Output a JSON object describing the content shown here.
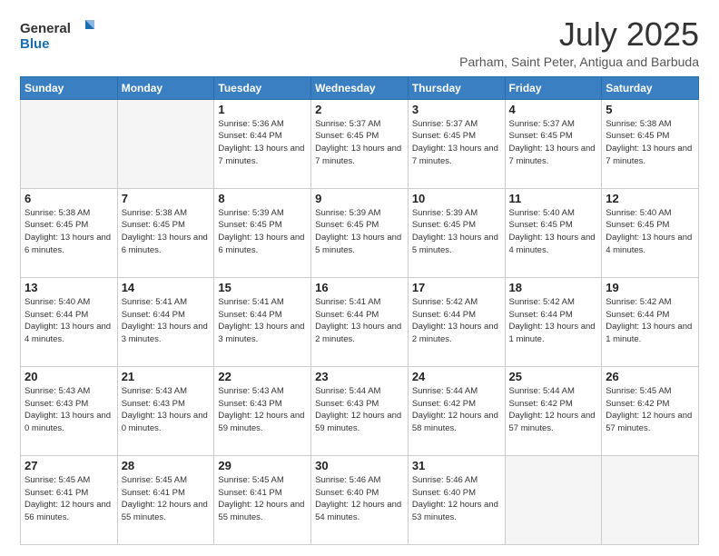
{
  "header": {
    "logo_line1": "General",
    "logo_line2": "Blue",
    "month": "July 2025",
    "location": "Parham, Saint Peter, Antigua and Barbuda"
  },
  "weekdays": [
    "Sunday",
    "Monday",
    "Tuesday",
    "Wednesday",
    "Thursday",
    "Friday",
    "Saturday"
  ],
  "weeks": [
    [
      {
        "day": "",
        "info": ""
      },
      {
        "day": "",
        "info": ""
      },
      {
        "day": "1",
        "info": "Sunrise: 5:36 AM\nSunset: 6:44 PM\nDaylight: 13 hours and 7 minutes."
      },
      {
        "day": "2",
        "info": "Sunrise: 5:37 AM\nSunset: 6:45 PM\nDaylight: 13 hours and 7 minutes."
      },
      {
        "day": "3",
        "info": "Sunrise: 5:37 AM\nSunset: 6:45 PM\nDaylight: 13 hours and 7 minutes."
      },
      {
        "day": "4",
        "info": "Sunrise: 5:37 AM\nSunset: 6:45 PM\nDaylight: 13 hours and 7 minutes."
      },
      {
        "day": "5",
        "info": "Sunrise: 5:38 AM\nSunset: 6:45 PM\nDaylight: 13 hours and 7 minutes."
      }
    ],
    [
      {
        "day": "6",
        "info": "Sunrise: 5:38 AM\nSunset: 6:45 PM\nDaylight: 13 hours and 6 minutes."
      },
      {
        "day": "7",
        "info": "Sunrise: 5:38 AM\nSunset: 6:45 PM\nDaylight: 13 hours and 6 minutes."
      },
      {
        "day": "8",
        "info": "Sunrise: 5:39 AM\nSunset: 6:45 PM\nDaylight: 13 hours and 6 minutes."
      },
      {
        "day": "9",
        "info": "Sunrise: 5:39 AM\nSunset: 6:45 PM\nDaylight: 13 hours and 5 minutes."
      },
      {
        "day": "10",
        "info": "Sunrise: 5:39 AM\nSunset: 6:45 PM\nDaylight: 13 hours and 5 minutes."
      },
      {
        "day": "11",
        "info": "Sunrise: 5:40 AM\nSunset: 6:45 PM\nDaylight: 13 hours and 4 minutes."
      },
      {
        "day": "12",
        "info": "Sunrise: 5:40 AM\nSunset: 6:45 PM\nDaylight: 13 hours and 4 minutes."
      }
    ],
    [
      {
        "day": "13",
        "info": "Sunrise: 5:40 AM\nSunset: 6:44 PM\nDaylight: 13 hours and 4 minutes."
      },
      {
        "day": "14",
        "info": "Sunrise: 5:41 AM\nSunset: 6:44 PM\nDaylight: 13 hours and 3 minutes."
      },
      {
        "day": "15",
        "info": "Sunrise: 5:41 AM\nSunset: 6:44 PM\nDaylight: 13 hours and 3 minutes."
      },
      {
        "day": "16",
        "info": "Sunrise: 5:41 AM\nSunset: 6:44 PM\nDaylight: 13 hours and 2 minutes."
      },
      {
        "day": "17",
        "info": "Sunrise: 5:42 AM\nSunset: 6:44 PM\nDaylight: 13 hours and 2 minutes."
      },
      {
        "day": "18",
        "info": "Sunrise: 5:42 AM\nSunset: 6:44 PM\nDaylight: 13 hours and 1 minute."
      },
      {
        "day": "19",
        "info": "Sunrise: 5:42 AM\nSunset: 6:44 PM\nDaylight: 13 hours and 1 minute."
      }
    ],
    [
      {
        "day": "20",
        "info": "Sunrise: 5:43 AM\nSunset: 6:43 PM\nDaylight: 13 hours and 0 minutes."
      },
      {
        "day": "21",
        "info": "Sunrise: 5:43 AM\nSunset: 6:43 PM\nDaylight: 13 hours and 0 minutes."
      },
      {
        "day": "22",
        "info": "Sunrise: 5:43 AM\nSunset: 6:43 PM\nDaylight: 12 hours and 59 minutes."
      },
      {
        "day": "23",
        "info": "Sunrise: 5:44 AM\nSunset: 6:43 PM\nDaylight: 12 hours and 59 minutes."
      },
      {
        "day": "24",
        "info": "Sunrise: 5:44 AM\nSunset: 6:42 PM\nDaylight: 12 hours and 58 minutes."
      },
      {
        "day": "25",
        "info": "Sunrise: 5:44 AM\nSunset: 6:42 PM\nDaylight: 12 hours and 57 minutes."
      },
      {
        "day": "26",
        "info": "Sunrise: 5:45 AM\nSunset: 6:42 PM\nDaylight: 12 hours and 57 minutes."
      }
    ],
    [
      {
        "day": "27",
        "info": "Sunrise: 5:45 AM\nSunset: 6:41 PM\nDaylight: 12 hours and 56 minutes."
      },
      {
        "day": "28",
        "info": "Sunrise: 5:45 AM\nSunset: 6:41 PM\nDaylight: 12 hours and 55 minutes."
      },
      {
        "day": "29",
        "info": "Sunrise: 5:45 AM\nSunset: 6:41 PM\nDaylight: 12 hours and 55 minutes."
      },
      {
        "day": "30",
        "info": "Sunrise: 5:46 AM\nSunset: 6:40 PM\nDaylight: 12 hours and 54 minutes."
      },
      {
        "day": "31",
        "info": "Sunrise: 5:46 AM\nSunset: 6:40 PM\nDaylight: 12 hours and 53 minutes."
      },
      {
        "day": "",
        "info": ""
      },
      {
        "day": "",
        "info": ""
      }
    ]
  ]
}
